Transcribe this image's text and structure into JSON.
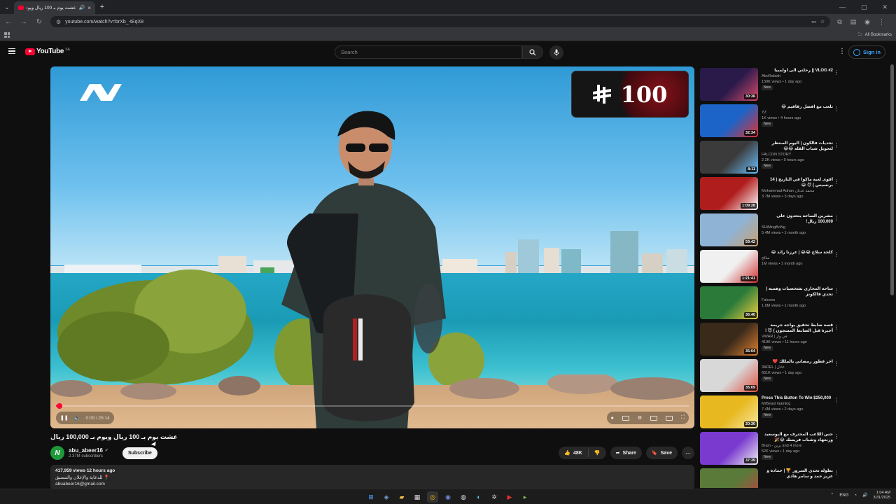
{
  "browser": {
    "tab_title": "عشت يوم بـ 100 ريال ويوم",
    "url": "youtube.com/watch?v=brXb_-tEqX8",
    "all_bookmarks": "All Bookmarks"
  },
  "header": {
    "logo": "YouTube",
    "region": "SA",
    "search_placeholder": "Search",
    "signin": "Sign in"
  },
  "player": {
    "badge_number": "100",
    "time_label": "0:09 / 25:14",
    "progress": 0.006
  },
  "video": {
    "title": "عشت يوم بـ 100 ريال ويوم بـ 100,000 ريال",
    "channel": "abu_abeer16",
    "subscribers": "2.37M subscribers",
    "subscribe": "Subscribe",
    "likes": "48K",
    "share": "Share",
    "save": "Save",
    "views_time": "417,959 views  12 hours ago",
    "desc_line1": "للدعاية والإعلان والتنسيق 📍",
    "desc_line2": "abuabeer16@gmail.com"
  },
  "recommendations": [
    {
      "title": "VLOG #2 || رحلتي الى اولمبيا",
      "channel": "AboRabiah",
      "meta": "130K views • 1 day ago",
      "badge": "New",
      "duration": "30:36",
      "colors": [
        "#2a1a4a",
        "#d94a6b"
      ],
      "ltr": false
    },
    {
      "title": "تلعب مع افضل رقاقيم 😂",
      "channel": "YZ",
      "meta": "1K views • 4 hours ago",
      "badge": "New",
      "duration": "32:34",
      "colors": [
        "#1c64c8",
        "#e03030"
      ],
      "ltr": false
    },
    {
      "title": "تحديات فالكون | اليوم المنتظر لتحويل شباب القلة 😂😂",
      "channel": "FALCON STORY",
      "meta": "2.2K views • 9 hours ago",
      "badge": "New",
      "duration": "8:11",
      "colors": [
        "#3b3b3b",
        "#6ac0ff"
      ],
      "ltr": false
    },
    {
      "title": "أقوى لعبة ماكوا في التاريخ ( 14 برنسيس ) 😈 😂",
      "channel": "Mohammad Adnan محمد عدنان",
      "meta": "3.7M views • 3 days ago",
      "badge": "",
      "duration": "1:09:28",
      "colors": [
        "#b01d1d",
        "#ffffff"
      ],
      "ltr": false
    },
    {
      "title": "مشرين الساحة يتحدون على 100,000 ريال!",
      "channel": "SHiNingBoNg",
      "meta": "5.4M views • 1 month ago",
      "badge": "",
      "duration": "59:42",
      "colors": [
        "#8fb3d4",
        "#c8a070"
      ],
      "ltr": false
    },
    {
      "title": "كلحة سلاح 😂😂 | عرزنا رائد 😂",
      "channel": "سالح",
      "meta": "1M views • 1 month ago",
      "badge": "",
      "duration": "1:21:41",
      "colors": [
        "#f0f0f0",
        "#d03030"
      ],
      "ltr": false
    },
    {
      "title": "ساحة المحاري بشخصيات وهمية | تحدي فالكونز",
      "channel": "Falcons",
      "meta": "1.6M views • 1 month ago",
      "badge": "",
      "duration": "36:40",
      "colors": [
        "#2b7a3a",
        "#f0d040"
      ],
      "ltr": false
    },
    {
      "title": "قصة ضابط تحقيق يواجه جريمة أخيرة قبل الضابط المسجون ) 😈 !",
      "channel": "VWAR | في وار",
      "meta": "419K views • 11 hours ago",
      "badge": "New",
      "duration": "36:04",
      "colors": [
        "#3a2a1a",
        "#e08030"
      ],
      "ltr": false
    },
    {
      "title": "اخر فطور رمضاني بالمللك ❤️",
      "channel": "3ADEL | عادل",
      "meta": "651K views • 1 day ago",
      "badge": "New",
      "duration": "35:09",
      "colors": [
        "#d8d8d8",
        "#e05040"
      ],
      "ltr": false
    },
    {
      "title": "Press This Button To Win $250,000",
      "channel": "MrBeast Gaming",
      "meta": "7.4M views • 2 days ago",
      "badge": "New",
      "duration": "20:30",
      "colors": [
        "#e8b820",
        "#f6e7a0"
      ],
      "ltr": true
    },
    {
      "title": "حس اللاعب المحترف مع البوسعيد ورنعهاد وشباب فريسك 😂🎉",
      "channel": "Brain - برين and 4 more",
      "meta": "52K views • 1 day ago",
      "badge": "New",
      "duration": "37:39",
      "colors": [
        "#7a3ad0",
        "#f0f0f0"
      ],
      "ltr": false
    },
    {
      "title": "بطولة تحدي السرور 🏆 | حماده و عزيز حمد و سامر هادي",
      "channel": "",
      "meta": "",
      "badge": "",
      "duration": "",
      "colors": [
        "#5a7a3a",
        "#c04040"
      ],
      "ltr": false
    }
  ],
  "taskbar": {
    "lang": "ENG",
    "time": "1:04 AM",
    "date": "3/31/2025"
  }
}
